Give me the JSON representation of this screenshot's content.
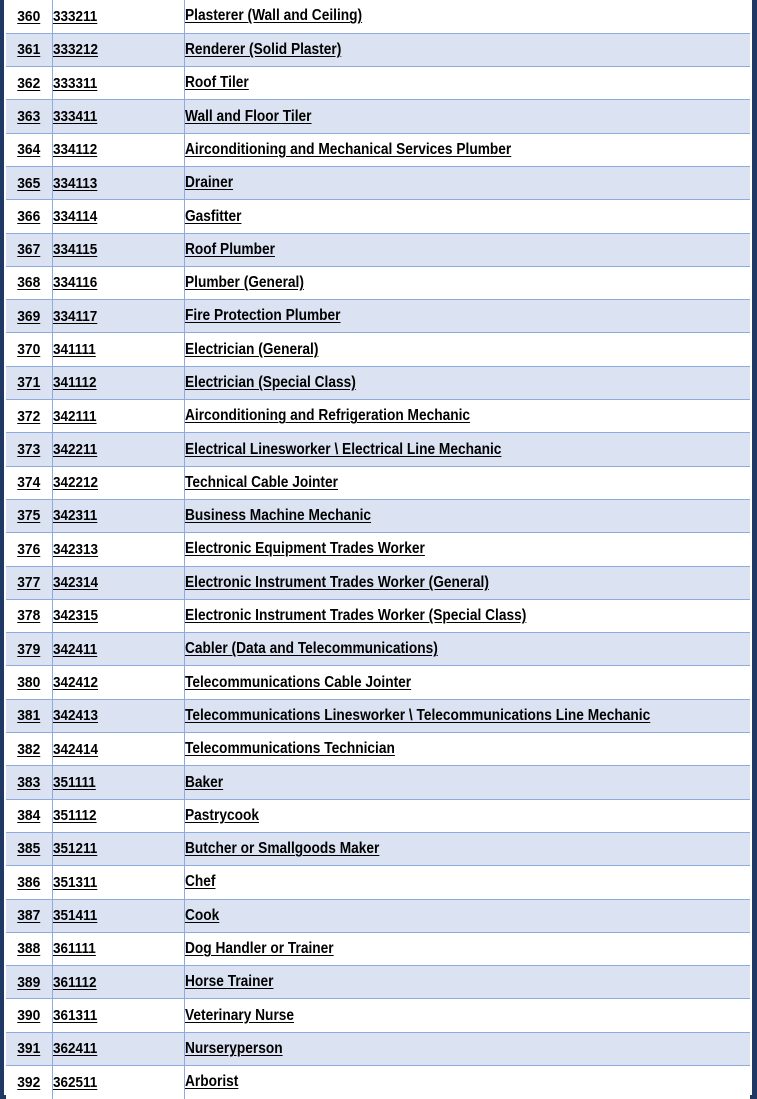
{
  "document": {
    "type": "occupation-code-table",
    "columns": [
      "index",
      "code",
      "occupation_title"
    ],
    "row_count": 33,
    "index_range": [
      360,
      392
    ],
    "styling": {
      "outer_border_color": "#1f3864",
      "grid_line_color": "#8faadc",
      "shaded_row_color": "#dbe2f1",
      "unshaded_row_color": "#ffffff",
      "text_color": "#000000"
    },
    "rows": [
      {
        "index": "360",
        "code": "333211",
        "title": "Plasterer (Wall and Ceiling)",
        "shaded": false
      },
      {
        "index": "361",
        "code": "333212",
        "title": "Renderer (Solid Plaster)",
        "shaded": true
      },
      {
        "index": "362",
        "code": "333311",
        "title": "Roof Tiler",
        "shaded": false
      },
      {
        "index": "363",
        "code": "333411",
        "title": "Wall and Floor Tiler",
        "shaded": true
      },
      {
        "index": "364",
        "code": "334112",
        "title": "Airconditioning and Mechanical Services Plumber",
        "shaded": false
      },
      {
        "index": "365",
        "code": "334113",
        "title": "Drainer",
        "shaded": true
      },
      {
        "index": "366",
        "code": "334114",
        "title": "Gasfitter",
        "shaded": false
      },
      {
        "index": "367",
        "code": "334115",
        "title": "Roof Plumber",
        "shaded": true
      },
      {
        "index": "368",
        "code": "334116",
        "title": "Plumber (General)",
        "shaded": false
      },
      {
        "index": "369",
        "code": "334117",
        "title": "Fire Protection Plumber",
        "shaded": true
      },
      {
        "index": "370",
        "code": "341111",
        "title": "Electrician (General)",
        "shaded": false
      },
      {
        "index": "371",
        "code": "341112",
        "title": "Electrician (Special Class)",
        "shaded": true
      },
      {
        "index": "372",
        "code": "342111",
        "title": "Airconditioning and Refrigeration Mechanic",
        "shaded": false
      },
      {
        "index": "373",
        "code": "342211",
        "title": "Electrical Linesworker \\ Electrical Line Mechanic",
        "shaded": true
      },
      {
        "index": "374",
        "code": "342212",
        "title": "Technical Cable Jointer",
        "shaded": false
      },
      {
        "index": "375",
        "code": "342311",
        "title": "Business Machine Mechanic",
        "shaded": true
      },
      {
        "index": "376",
        "code": "342313",
        "title": "Electronic Equipment Trades Worker",
        "shaded": false
      },
      {
        "index": "377",
        "code": "342314",
        "title": "Electronic Instrument Trades Worker (General)",
        "shaded": true
      },
      {
        "index": "378",
        "code": "342315",
        "title": "Electronic Instrument Trades Worker (Special Class)",
        "shaded": false
      },
      {
        "index": "379",
        "code": "342411",
        "title": "Cabler (Data and Telecommunications)",
        "shaded": true
      },
      {
        "index": "380",
        "code": "342412",
        "title": "Telecommunications Cable Jointer",
        "shaded": false
      },
      {
        "index": "381",
        "code": "342413",
        "title": "Telecommunications Linesworker \\ Telecommunications Line Mechanic",
        "shaded": true
      },
      {
        "index": "382",
        "code": "342414",
        "title": "Telecommunications Technician",
        "shaded": false
      },
      {
        "index": "383",
        "code": "351111",
        "title": "Baker",
        "shaded": true
      },
      {
        "index": "384",
        "code": "351112",
        "title": "Pastrycook",
        "shaded": false
      },
      {
        "index": "385",
        "code": "351211",
        "title": "Butcher or Smallgoods Maker",
        "shaded": true
      },
      {
        "index": "386",
        "code": "351311",
        "title": "Chef",
        "shaded": false
      },
      {
        "index": "387",
        "code": "351411",
        "title": "Cook",
        "shaded": true
      },
      {
        "index": "388",
        "code": "361111",
        "title": "Dog Handler or Trainer",
        "shaded": false
      },
      {
        "index": "389",
        "code": "361112",
        "title": "Horse Trainer",
        "shaded": true
      },
      {
        "index": "390",
        "code": "361311",
        "title": "Veterinary Nurse",
        "shaded": false
      },
      {
        "index": "391",
        "code": "362411",
        "title": "Nurseryperson",
        "shaded": true
      },
      {
        "index": "392",
        "code": "362511",
        "title": "Arborist",
        "shaded": false
      }
    ]
  }
}
